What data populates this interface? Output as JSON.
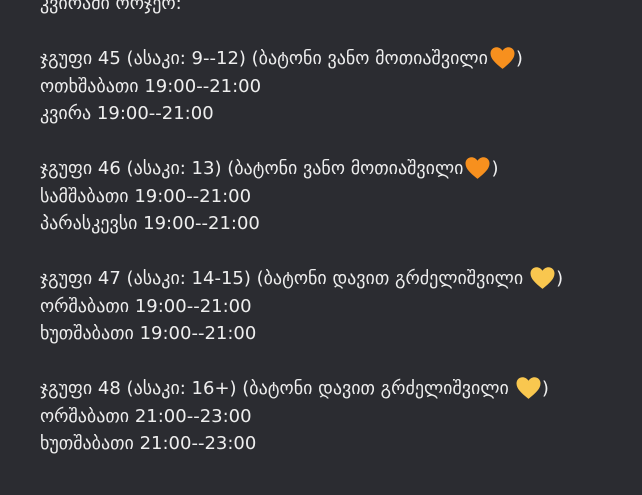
{
  "colors": {
    "background": "#2b2c31",
    "text": "#eeeeee",
    "heart_orange": "#f7901e",
    "heart_yellow": "#f9c74f"
  },
  "header": {
    "text": "კვირაში ორჯერ:"
  },
  "groups": [
    {
      "title": "ჯგუფი 45 (ასაკი: 9--12) (ბატონი ვანო მოთიაშვილი",
      "heart_icon": "orange-heart",
      "title_end": ")",
      "schedule": [
        "ოთხშაბათი 19:00--21:00",
        "კვირა 19:00--21:00"
      ]
    },
    {
      "title": "ჯგუფი 46 (ასაკი: 13) (ბატონი ვანო მოთიაშვილი",
      "heart_icon": "orange-heart",
      "title_end": ")",
      "schedule": [
        "სამშაბათი 19:00--21:00",
        "პარასკევსი 19:00--21:00"
      ]
    },
    {
      "title": "ჯგუფი 47 (ასაკი: 14-15) (ბატონი დავით გრძელიშვილი",
      "heart_icon": "yellow-heart",
      "title_end": ")",
      "schedule": [
        "ორშაბათი  19:00--21:00",
        "ხუთშაბათი  19:00--21:00"
      ]
    },
    {
      "title": "ჯგუფი 48 (ასაკი: 16+) (ბატონი დავით გრძელიშვილი",
      "heart_icon": "yellow-heart",
      "title_end": ")",
      "schedule": [
        "ორშაბათი  21:00--23:00",
        "ხუთშაბათი  21:00--23:00"
      ]
    }
  ]
}
